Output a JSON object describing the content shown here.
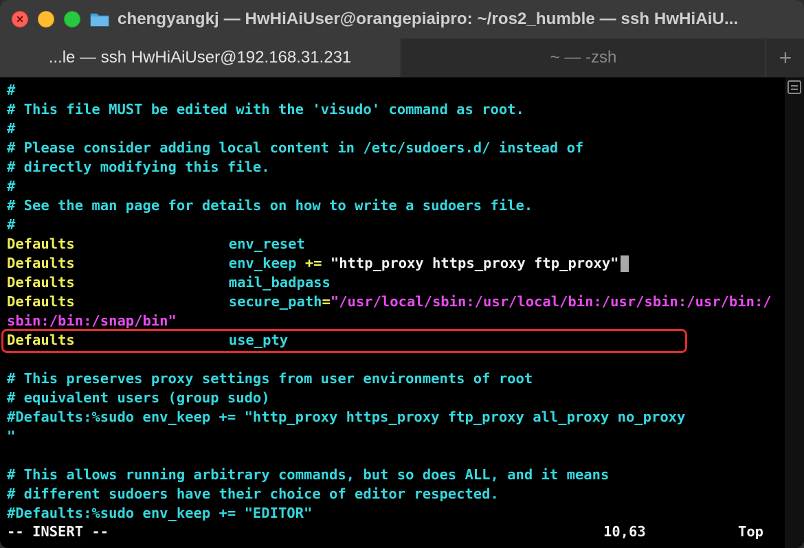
{
  "window": {
    "title": "chengyangkj — HwHiAiUser@orangepiaipro: ~/ros2_humble — ssh HwHiAiU..."
  },
  "tabs": [
    {
      "label": "...le — ssh HwHiAiUser@192.168.31.231"
    },
    {
      "label": "~ — -zsh"
    }
  ],
  "tab_add_label": "+",
  "terminal": {
    "comments_top": [
      "#",
      "# This file MUST be edited with the 'visudo' command as root.",
      "#",
      "# Please consider adding local content in /etc/sudoers.d/ instead of",
      "# directly modifying this file.",
      "#",
      "# See the man page for details on how to write a sudoers file.",
      "#"
    ],
    "defaults_keyword": "Defaults",
    "env_reset": "env_reset",
    "env_keep_key": "env_keep",
    "env_keep_op": " +=",
    "env_keep_value": " \"http_proxy https_proxy ftp_proxy\"",
    "mail_badpass": "mail_badpass",
    "secure_path_key": "secure_path",
    "secure_path_eq": "=",
    "secure_path_value_1": "\"/usr/local/sbin:/usr/local/bin:/usr/sbin:/usr/bin:/",
    "secure_path_value_2": "sbin:/bin:/snap/bin\"",
    "use_pty": "use_pty",
    "comments_bottom": [
      "# This preserves proxy settings from user environments of root",
      "# equivalent users (group sudo)",
      "#Defaults:%sudo env_keep += \"http_proxy https_proxy ftp_proxy all_proxy no_proxy",
      "\"",
      "",
      "# This allows running arbitrary commands, but so does ALL, and it means",
      "# different sudoers have their choice of editor respected.",
      "#Defaults:%sudo env_keep += \"EDITOR\""
    ]
  },
  "status_bar": {
    "mode": "-- INSERT --",
    "position": "10,63",
    "scroll": "Top"
  },
  "colors": {
    "comment": "#36d9e0",
    "keyword": "#efef5a",
    "string": "#e84cf0",
    "highlight_box": "#e32b2b"
  },
  "icons": {
    "close": "close-icon",
    "folder": "folder-icon"
  }
}
